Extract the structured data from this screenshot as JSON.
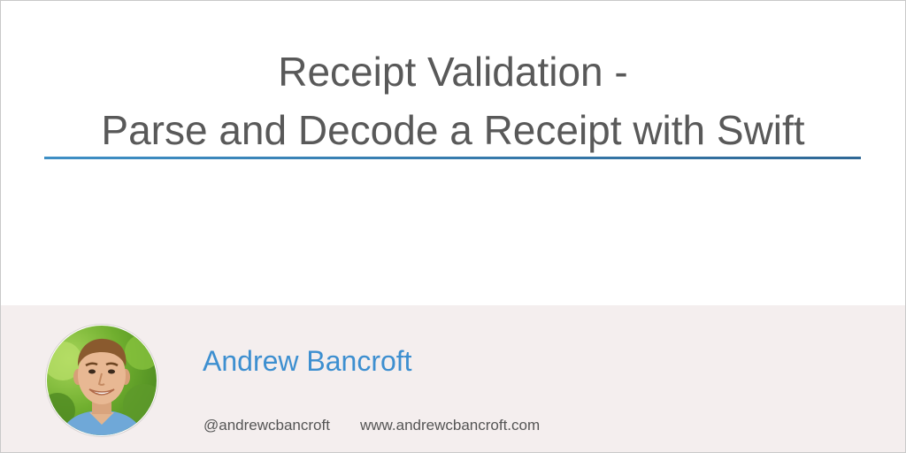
{
  "title": {
    "line1": "Receipt Validation -",
    "line2": "Parse and Decode a Receipt with Swift"
  },
  "author": {
    "name": "Andrew Bancroft",
    "handle": "@andrewcbancroft",
    "website": "www.andrewcbancroft.com"
  },
  "colors": {
    "title_text": "#595959",
    "rule_start": "#3e8fc5",
    "rule_end": "#2f6896",
    "author_name": "#3d8fd0",
    "footer_bg": "#f4eeee"
  }
}
